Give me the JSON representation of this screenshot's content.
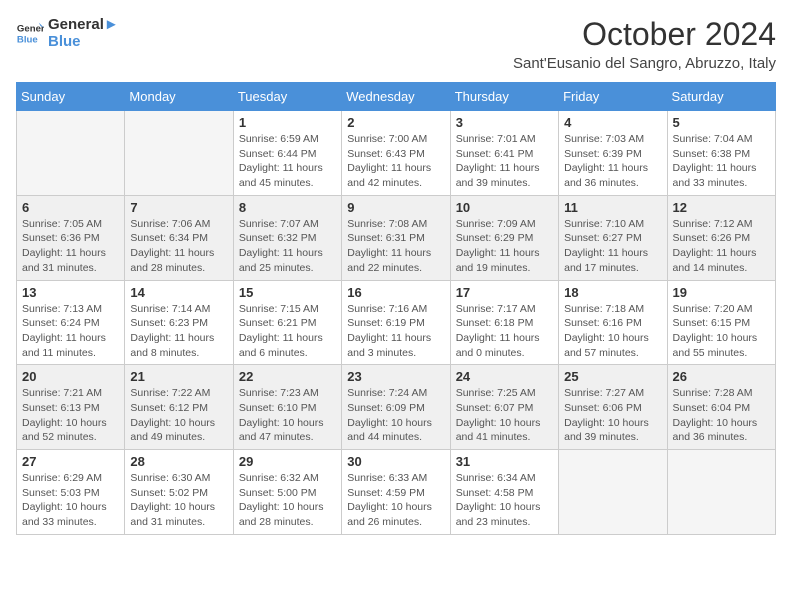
{
  "logo": {
    "line1": "General",
    "line2": "Blue"
  },
  "title": "October 2024",
  "location": "Sant'Eusanio del Sangro, Abruzzo, Italy",
  "days_of_week": [
    "Sunday",
    "Monday",
    "Tuesday",
    "Wednesday",
    "Thursday",
    "Friday",
    "Saturday"
  ],
  "weeks": [
    [
      {
        "day": "",
        "info": ""
      },
      {
        "day": "",
        "info": ""
      },
      {
        "day": "1",
        "info": "Sunrise: 6:59 AM\nSunset: 6:44 PM\nDaylight: 11 hours and 45 minutes."
      },
      {
        "day": "2",
        "info": "Sunrise: 7:00 AM\nSunset: 6:43 PM\nDaylight: 11 hours and 42 minutes."
      },
      {
        "day": "3",
        "info": "Sunrise: 7:01 AM\nSunset: 6:41 PM\nDaylight: 11 hours and 39 minutes."
      },
      {
        "day": "4",
        "info": "Sunrise: 7:03 AM\nSunset: 6:39 PM\nDaylight: 11 hours and 36 minutes."
      },
      {
        "day": "5",
        "info": "Sunrise: 7:04 AM\nSunset: 6:38 PM\nDaylight: 11 hours and 33 minutes."
      }
    ],
    [
      {
        "day": "6",
        "info": "Sunrise: 7:05 AM\nSunset: 6:36 PM\nDaylight: 11 hours and 31 minutes."
      },
      {
        "day": "7",
        "info": "Sunrise: 7:06 AM\nSunset: 6:34 PM\nDaylight: 11 hours and 28 minutes."
      },
      {
        "day": "8",
        "info": "Sunrise: 7:07 AM\nSunset: 6:32 PM\nDaylight: 11 hours and 25 minutes."
      },
      {
        "day": "9",
        "info": "Sunrise: 7:08 AM\nSunset: 6:31 PM\nDaylight: 11 hours and 22 minutes."
      },
      {
        "day": "10",
        "info": "Sunrise: 7:09 AM\nSunset: 6:29 PM\nDaylight: 11 hours and 19 minutes."
      },
      {
        "day": "11",
        "info": "Sunrise: 7:10 AM\nSunset: 6:27 PM\nDaylight: 11 hours and 17 minutes."
      },
      {
        "day": "12",
        "info": "Sunrise: 7:12 AM\nSunset: 6:26 PM\nDaylight: 11 hours and 14 minutes."
      }
    ],
    [
      {
        "day": "13",
        "info": "Sunrise: 7:13 AM\nSunset: 6:24 PM\nDaylight: 11 hours and 11 minutes."
      },
      {
        "day": "14",
        "info": "Sunrise: 7:14 AM\nSunset: 6:23 PM\nDaylight: 11 hours and 8 minutes."
      },
      {
        "day": "15",
        "info": "Sunrise: 7:15 AM\nSunset: 6:21 PM\nDaylight: 11 hours and 6 minutes."
      },
      {
        "day": "16",
        "info": "Sunrise: 7:16 AM\nSunset: 6:19 PM\nDaylight: 11 hours and 3 minutes."
      },
      {
        "day": "17",
        "info": "Sunrise: 7:17 AM\nSunset: 6:18 PM\nDaylight: 11 hours and 0 minutes."
      },
      {
        "day": "18",
        "info": "Sunrise: 7:18 AM\nSunset: 6:16 PM\nDaylight: 10 hours and 57 minutes."
      },
      {
        "day": "19",
        "info": "Sunrise: 7:20 AM\nSunset: 6:15 PM\nDaylight: 10 hours and 55 minutes."
      }
    ],
    [
      {
        "day": "20",
        "info": "Sunrise: 7:21 AM\nSunset: 6:13 PM\nDaylight: 10 hours and 52 minutes."
      },
      {
        "day": "21",
        "info": "Sunrise: 7:22 AM\nSunset: 6:12 PM\nDaylight: 10 hours and 49 minutes."
      },
      {
        "day": "22",
        "info": "Sunrise: 7:23 AM\nSunset: 6:10 PM\nDaylight: 10 hours and 47 minutes."
      },
      {
        "day": "23",
        "info": "Sunrise: 7:24 AM\nSunset: 6:09 PM\nDaylight: 10 hours and 44 minutes."
      },
      {
        "day": "24",
        "info": "Sunrise: 7:25 AM\nSunset: 6:07 PM\nDaylight: 10 hours and 41 minutes."
      },
      {
        "day": "25",
        "info": "Sunrise: 7:27 AM\nSunset: 6:06 PM\nDaylight: 10 hours and 39 minutes."
      },
      {
        "day": "26",
        "info": "Sunrise: 7:28 AM\nSunset: 6:04 PM\nDaylight: 10 hours and 36 minutes."
      }
    ],
    [
      {
        "day": "27",
        "info": "Sunrise: 6:29 AM\nSunset: 5:03 PM\nDaylight: 10 hours and 33 minutes."
      },
      {
        "day": "28",
        "info": "Sunrise: 6:30 AM\nSunset: 5:02 PM\nDaylight: 10 hours and 31 minutes."
      },
      {
        "day": "29",
        "info": "Sunrise: 6:32 AM\nSunset: 5:00 PM\nDaylight: 10 hours and 28 minutes."
      },
      {
        "day": "30",
        "info": "Sunrise: 6:33 AM\nSunset: 4:59 PM\nDaylight: 10 hours and 26 minutes."
      },
      {
        "day": "31",
        "info": "Sunrise: 6:34 AM\nSunset: 4:58 PM\nDaylight: 10 hours and 23 minutes."
      },
      {
        "day": "",
        "info": ""
      },
      {
        "day": "",
        "info": ""
      }
    ]
  ]
}
